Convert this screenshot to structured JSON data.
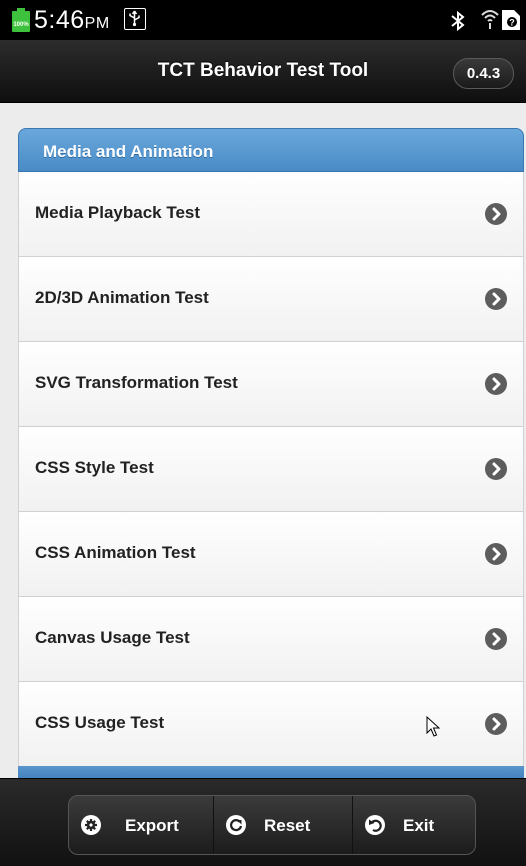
{
  "status_bar": {
    "battery_percent": "100%",
    "time": "5:46",
    "ampm": "PM",
    "icons": [
      "battery-icon",
      "usb-icon",
      "bluetooth-icon",
      "wifi-icon",
      "sim-icon"
    ]
  },
  "header": {
    "title": "TCT Behavior Test Tool",
    "version": "0.4.3"
  },
  "list": {
    "header": "Media and Animation",
    "items": [
      {
        "label": "Media Playback Test"
      },
      {
        "label": "2D/3D Animation Test"
      },
      {
        "label": "SVG Transformation Test"
      },
      {
        "label": "CSS Style Test"
      },
      {
        "label": "CSS Animation Test"
      },
      {
        "label": "Canvas Usage Test"
      },
      {
        "label": "CSS Usage Test"
      }
    ]
  },
  "toolbar": {
    "export_label": "Export",
    "reset_label": "Reset",
    "exit_label": "Exit"
  },
  "colors": {
    "accent": "#4a8bc6",
    "battery": "#3ec23e"
  }
}
